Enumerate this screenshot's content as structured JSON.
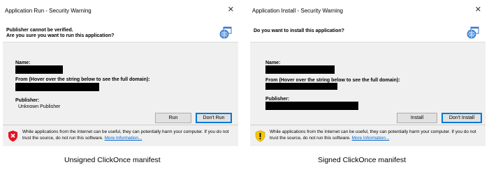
{
  "dialogs": [
    {
      "title": "Application Run - Security Warning",
      "close_symbol": "✕",
      "header_lines": [
        "Publisher cannot be verified.",
        "Are you sure you want to run this application?"
      ],
      "name_label": "Name:",
      "from_label": "From (Hover over the string below to see the full domain):",
      "publisher_label": "Publisher:",
      "publisher_value": "Unknown Publisher",
      "primary_button": "Run",
      "secondary_button": "Don't Run",
      "footer_text": "While applications from the Internet can be useful, they can potentially harm your computer. If you do not trust the source, do not run this software.",
      "footer_link": "More Information...",
      "shield_icon": "red-shield-x-icon",
      "shield_color": "#e81123",
      "caption": "Unsigned ClickOnce manifest"
    },
    {
      "title": "Application Install - Security Warning",
      "close_symbol": "✕",
      "header_lines": [
        "Do you want to install this application?"
      ],
      "name_label": "Name:",
      "from_label": "From (Hover over the string below to see the full domain):",
      "publisher_label": "Publisher:",
      "primary_button": "Install",
      "secondary_button": "Don't Install",
      "footer_text": "While applications from the Internet can be useful, they can potentially harm your computer. If you do not trust the source, do not run this software.",
      "footer_link": "More Information...",
      "shield_icon": "yellow-shield-exclamation-icon",
      "shield_color": "#f7c600",
      "caption": "Signed ClickOnce manifest"
    }
  ],
  "colors": {
    "dialog_bg": "#f0f0f0",
    "accent": "#0078d7",
    "link": "#0066cc"
  }
}
